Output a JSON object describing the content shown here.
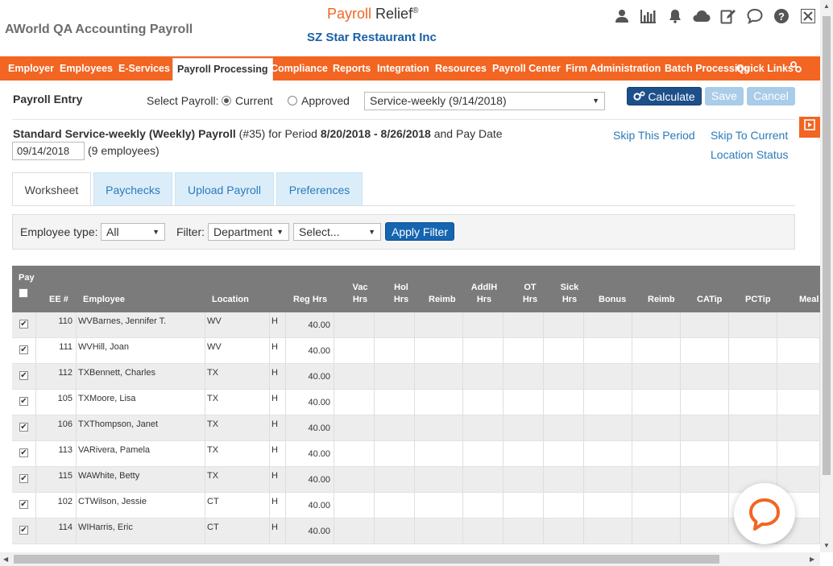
{
  "header": {
    "company": "AWorld QA Accounting Payroll",
    "brand_main": "Payroll",
    "brand_sub": "Relief",
    "brand_mark": "®",
    "client": "SZ Star Restaurant Inc",
    "icons": [
      "user-icon",
      "bar-chart-icon",
      "bell-icon",
      "cloud-icon",
      "edit-icon",
      "chat-icon",
      "help-icon",
      "close-icon"
    ]
  },
  "nav": {
    "items": [
      {
        "label": "Employer"
      },
      {
        "label": "Employees"
      },
      {
        "label": "E-Services"
      },
      {
        "label": "Payroll Processing",
        "active": true
      },
      {
        "label": "Compliance"
      },
      {
        "label": "Reports"
      },
      {
        "label": "Integration"
      },
      {
        "label": "Resources"
      },
      {
        "label": "Payroll Center"
      },
      {
        "label": "Firm Administration"
      },
      {
        "label": "Batch Processing"
      },
      {
        "label": "Quick Links"
      }
    ],
    "accent": "#f26522"
  },
  "entry": {
    "title": "Payroll Entry",
    "select_label": "Select Payroll:",
    "radio_current": "Current",
    "radio_approved": "Approved",
    "selected_payroll": "Service-weekly (9/14/2018)",
    "btn_calculate": "Calculate",
    "btn_save": "Save",
    "btn_cancel": "Cancel"
  },
  "period": {
    "name": "Standard Service-weekly (Weekly) Payroll",
    "number": "(#35)",
    "for_period_text": "for Period",
    "range": "8/20/2018 - 8/26/2018",
    "pay_date_text": "and Pay Date",
    "pay_date": "09/14/2018",
    "employee_count": "(9 employees)",
    "skip_period": "Skip This Period",
    "skip_current": "Skip To Current",
    "location_status": "Location Status"
  },
  "tabs": [
    "Worksheet",
    "Paychecks",
    "Upload Payroll",
    "Preferences"
  ],
  "filter": {
    "employee_type_label": "Employee type:",
    "employee_type_value": "All",
    "filter_label": "Filter:",
    "filter_value": "Department",
    "select_value": "Select...",
    "apply_label": "Apply Filter"
  },
  "grid": {
    "headers": {
      "pay": "Pay",
      "ee": "EE #",
      "employee": "Employee",
      "location": "Location",
      "reg_hrs": "Reg Hrs",
      "vac_hrs": [
        "Vac",
        "Hrs"
      ],
      "hol_hrs": [
        "Hol",
        "Hrs"
      ],
      "reimb1": "Reimb",
      "addlh_hrs": [
        "AddlH",
        "Hrs"
      ],
      "ot_hrs": [
        "OT",
        "Hrs"
      ],
      "sick_hrs": [
        "Sick",
        "Hrs"
      ],
      "bonus": "Bonus",
      "reimb2": "Reimb",
      "catip": "CATip",
      "pctip": "PCTip",
      "meal": "Meal"
    },
    "rows": [
      {
        "ee": "110",
        "employee": "WVBarnes, Jennifer T.",
        "location": "WV",
        "type": "H",
        "reg_hrs": "40.00"
      },
      {
        "ee": "111",
        "employee": "WVHill, Joan",
        "location": "WV",
        "type": "H",
        "reg_hrs": "40.00"
      },
      {
        "ee": "112",
        "employee": "TXBennett, Charles",
        "location": "TX",
        "type": "H",
        "reg_hrs": "40.00"
      },
      {
        "ee": "105",
        "employee": "TXMoore, Lisa",
        "location": "TX",
        "type": "H",
        "reg_hrs": "40.00"
      },
      {
        "ee": "106",
        "employee": "TXThompson, Janet",
        "location": "TX",
        "type": "H",
        "reg_hrs": "40.00"
      },
      {
        "ee": "113",
        "employee": "VARivera, Pamela",
        "location": "TX",
        "type": "H",
        "reg_hrs": "40.00"
      },
      {
        "ee": "115",
        "employee": "WAWhite, Betty",
        "location": "TX",
        "type": "H",
        "reg_hrs": "40.00"
      },
      {
        "ee": "102",
        "employee": "CTWilson, Jessie",
        "location": "CT",
        "type": "H",
        "reg_hrs": "40.00"
      },
      {
        "ee": "114",
        "employee": "WIHarris, Eric",
        "location": "CT",
        "type": "H",
        "reg_hrs": "40.00"
      }
    ]
  }
}
